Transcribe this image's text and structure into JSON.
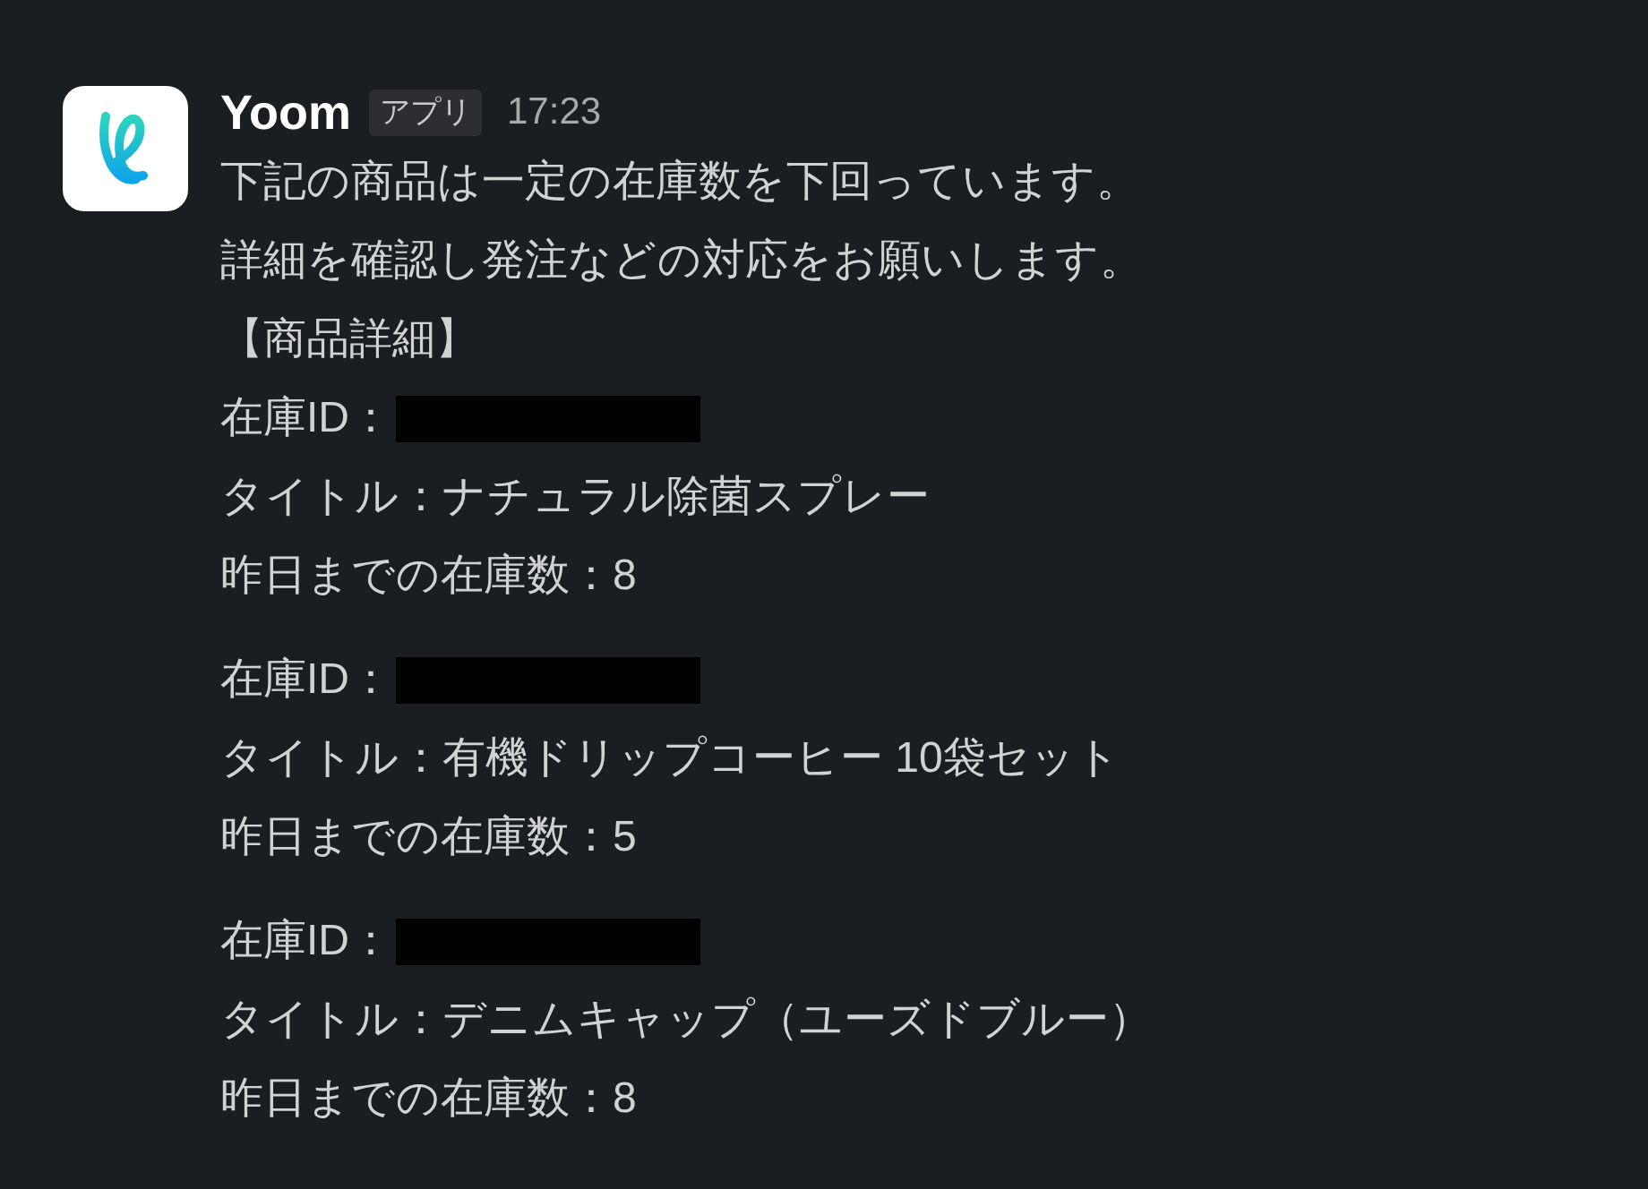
{
  "message": {
    "sender": "Yoom",
    "badge": "アプリ",
    "time": "17:23",
    "lines": [
      {
        "kind": "text",
        "text": "下記の商品は一定の在庫数を下回っています。"
      },
      {
        "kind": "text",
        "text": "詳細を確認し発注などの対応をお願いします。"
      },
      {
        "kind": "text",
        "text": "【商品詳細】"
      }
    ],
    "groups": [
      {
        "lines": [
          {
            "kind": "redacted",
            "text": "在庫ID："
          },
          {
            "kind": "text",
            "text": "タイトル：ナチュラル除菌スプレー"
          },
          {
            "kind": "text",
            "text": "昨日までの在庫数：8"
          }
        ]
      },
      {
        "lines": [
          {
            "kind": "redacted",
            "text": "在庫ID："
          },
          {
            "kind": "text",
            "text": "タイトル：有機ドリップコーヒー 10袋セット"
          },
          {
            "kind": "text",
            "text": "昨日までの在庫数：5"
          }
        ]
      },
      {
        "lines": [
          {
            "kind": "redacted",
            "text": "在庫ID："
          },
          {
            "kind": "text",
            "text": "タイトル：デニムキャップ（ユーズドブルー）"
          },
          {
            "kind": "text",
            "text": "昨日までの在庫数：8"
          }
        ]
      }
    ]
  }
}
